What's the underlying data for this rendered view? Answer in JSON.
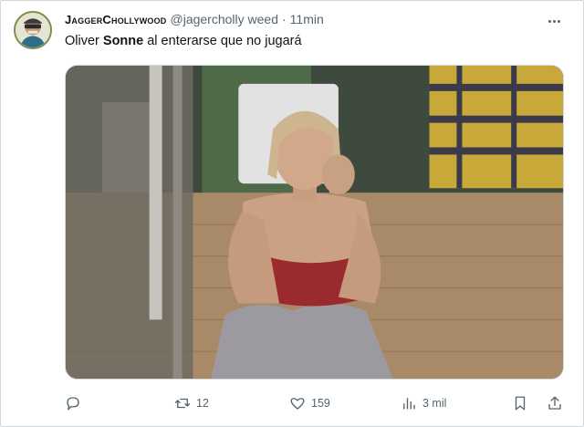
{
  "tweet": {
    "display_name": "JaggerChollywood",
    "handle": "@jagercholly weed",
    "separator": "·",
    "time": "11min",
    "text_before": "Oliver ",
    "text_bold": "Sonne",
    "text_after": " al enterarse que no jugará"
  },
  "actions": {
    "retweets": "12",
    "likes": "159",
    "views": "3 mil"
  },
  "icons": [
    "reply-icon",
    "retweet-icon",
    "like-icon",
    "views-icon",
    "bookmark-icon",
    "share-icon",
    "more-icon"
  ]
}
